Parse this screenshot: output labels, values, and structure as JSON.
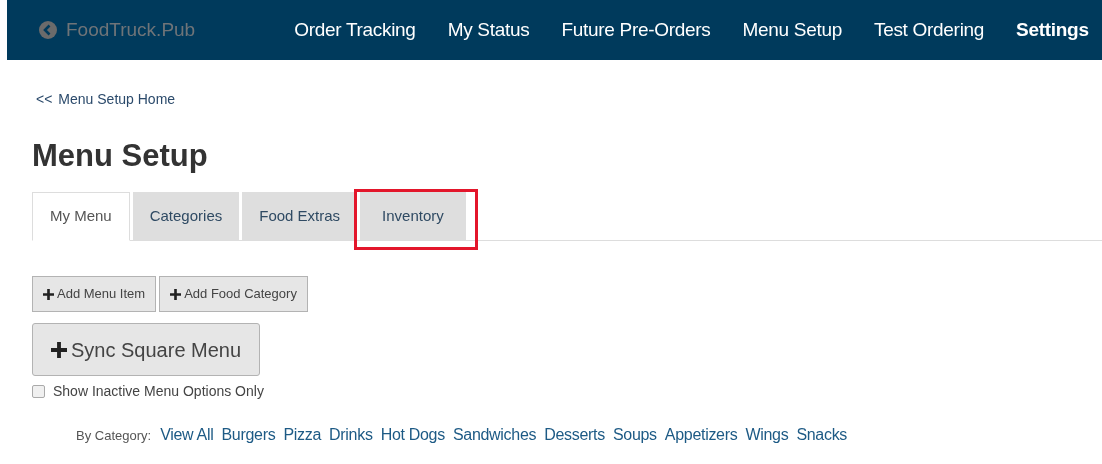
{
  "brand": {
    "name": "FoodTruck.Pub"
  },
  "nav": [
    {
      "label": "Order Tracking",
      "selected": false
    },
    {
      "label": "My Status",
      "selected": false
    },
    {
      "label": "Future Pre-Orders",
      "selected": false
    },
    {
      "label": "Menu Setup",
      "selected": false
    },
    {
      "label": "Test Ordering",
      "selected": false
    },
    {
      "label": "Settings",
      "selected": true
    }
  ],
  "breadcrumb": {
    "arrow": "<<",
    "label": "Menu Setup Home"
  },
  "title": "Menu Setup",
  "tabs": [
    {
      "label": "My Menu",
      "selected": true,
      "highlighted": false
    },
    {
      "label": "Categories",
      "selected": false,
      "highlighted": false
    },
    {
      "label": "Food Extras",
      "selected": false,
      "highlighted": false
    },
    {
      "label": "Inventory",
      "selected": false,
      "highlighted": true
    }
  ],
  "buttons": [
    {
      "label": "Add Menu Item",
      "kind": "small"
    },
    {
      "label": "Add Food Category",
      "kind": "small"
    },
    {
      "label": "Sync Square Menu",
      "kind": "large"
    }
  ],
  "inactive_only": {
    "label": "Show Inactive Menu Options Only",
    "checked": false
  },
  "category_filter": {
    "label": "By Category:",
    "links": [
      "View All",
      "Burgers",
      "Pizza",
      "Drinks",
      "Hot Dogs",
      "Sandwiches",
      "Desserts",
      "Soups",
      "Appetizers",
      "Wings",
      "Snacks"
    ]
  }
}
